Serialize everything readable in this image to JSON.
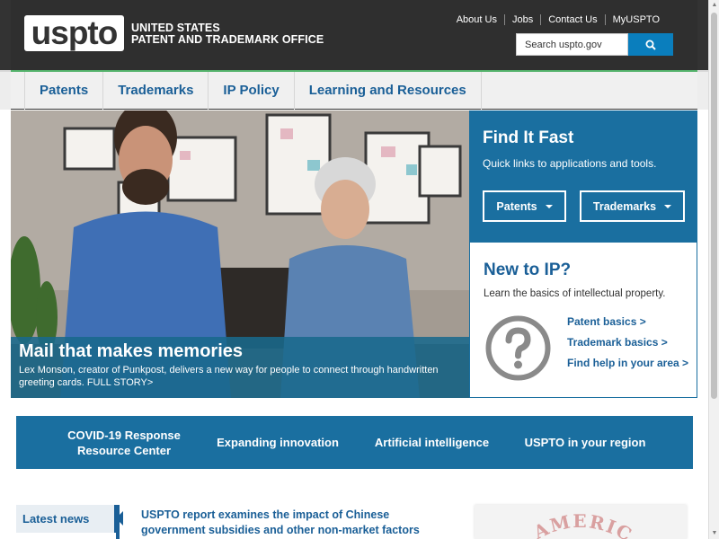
{
  "header": {
    "logo": "uspto",
    "org_line1": "UNITED STATES",
    "org_line2": "PATENT AND TRADEMARK OFFICE",
    "top_links": [
      "About Us",
      "Jobs",
      "Contact Us",
      "MyUSPTO"
    ],
    "search_placeholder": "Search uspto.gov",
    "search_icon": "search-icon"
  },
  "nav": {
    "items": [
      "Patents",
      "Trademarks",
      "IP Policy",
      "Learning and Resources"
    ]
  },
  "hero": {
    "title": "Mail that makes memories",
    "description": "Lex Monson, creator of Punkpost, delivers a new way for people to connect through handwritten greeting cards. FULL STORY>"
  },
  "find_it_fast": {
    "title": "Find It Fast",
    "subtitle": "Quick links to applications and tools.",
    "buttons": [
      "Patents",
      "Trademarks"
    ]
  },
  "new_to_ip": {
    "title": "New to IP?",
    "subtitle": "Learn the basics of intellectual property.",
    "icon": "question-icon",
    "links": [
      "Patent basics >",
      "Trademark basics >",
      "Find help in your area >"
    ]
  },
  "band": {
    "items": [
      "COVID-19 Response Resource Center",
      "Expanding innovation",
      "Artificial intelligence",
      "USPTO in your region"
    ]
  },
  "news": {
    "tab_label": "Latest news",
    "headline": "USPTO report examines the impact of Chinese government subsidies and other non-market factors"
  },
  "stamp": {
    "text": "AMERICAN"
  },
  "colors": {
    "brand_blue": "#1a6fa0",
    "link_blue": "#1a5f97",
    "header_dark": "#2f2f2f",
    "accent_green": "#54b26b"
  }
}
